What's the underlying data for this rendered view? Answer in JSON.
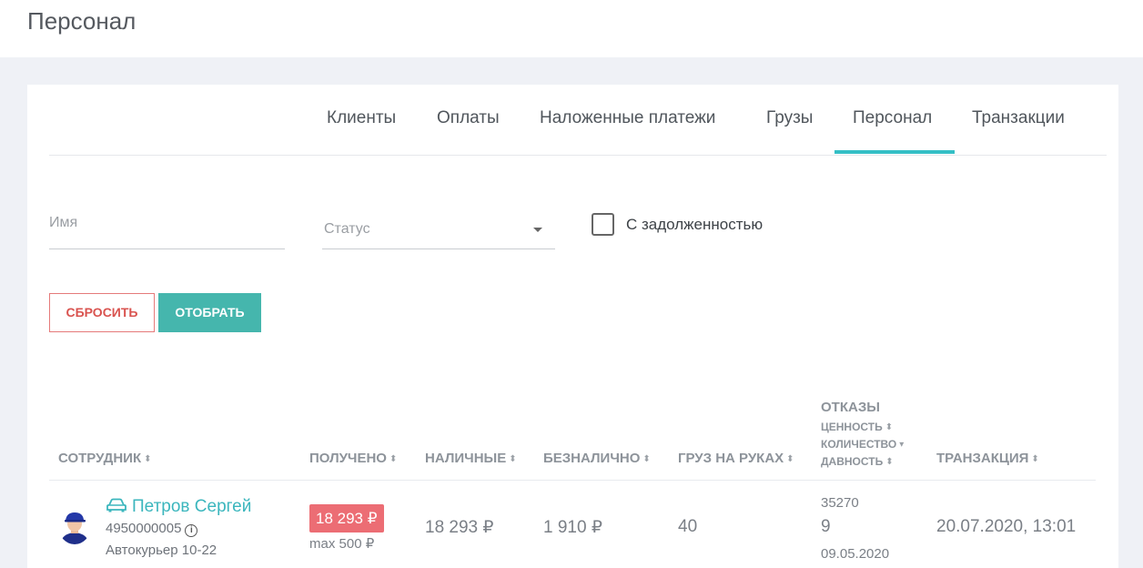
{
  "header": {
    "title": "Персонал"
  },
  "tabs": [
    {
      "label": "Клиенты"
    },
    {
      "label": "Оплаты"
    },
    {
      "label": "Наложенные платежи"
    },
    {
      "label": "Грузы"
    },
    {
      "label": "Персонал",
      "active": true
    },
    {
      "label": "Транзакции"
    }
  ],
  "filters": {
    "name_placeholder": "Имя",
    "status_placeholder": "Статус",
    "debt_checkbox_label": "С задолженностью",
    "debt_checked": false
  },
  "buttons": {
    "reset": "СБРОСИТЬ",
    "apply": "ОТОБРАТЬ"
  },
  "table": {
    "columns": {
      "employee": "СОТРУДНИК",
      "received": "ПОЛУЧЕНО",
      "cash": "НАЛИЧНЫЕ",
      "cashless": "БЕЗНАЛИЧНО",
      "cargo": "ГРУЗ НА РУКАХ",
      "refusals": "ОТКАЗЫ",
      "value": "ЦЕННОСТЬ",
      "quantity": "КОЛИЧЕСТВО",
      "age": "ДАВНОСТЬ",
      "transaction": "ТРАНЗАКЦИЯ"
    },
    "rows": [
      {
        "name": "Петров Сергей",
        "phone": "4950000005",
        "role": "Автокурьер 10-22",
        "received": "18 293 ₽",
        "received_max": "max 500 ₽",
        "cash": "18 293 ₽",
        "cashless": "1 910 ₽",
        "cargo": "40",
        "refusal_value": "35270",
        "refusal_count": "9",
        "refusal_date": "09.05.2020",
        "transaction": "20.07.2020, 13:01"
      }
    ]
  },
  "colors": {
    "accent": "#35bfc5",
    "badge": "#ec6d74",
    "reset": "#d9534f",
    "apply": "#45b6ad"
  }
}
